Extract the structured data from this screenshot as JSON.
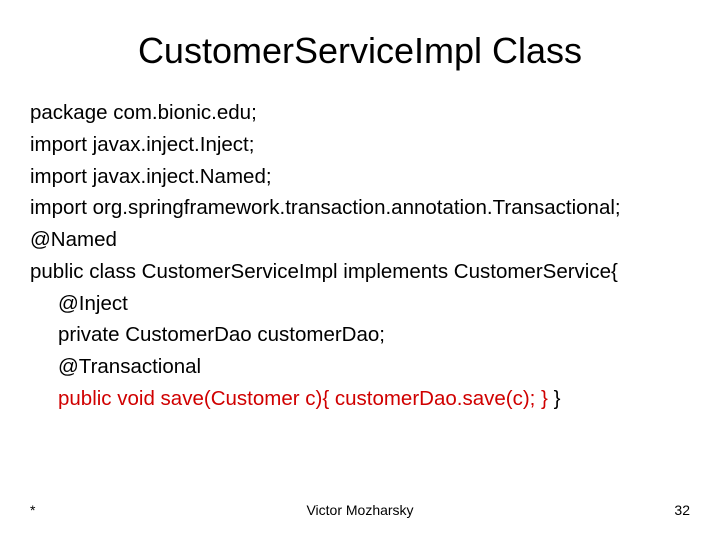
{
  "title": "CustomerServiceImpl Class",
  "code": {
    "l1": "package com.bionic.edu;",
    "l2": "import javax.inject.Inject;",
    "l3": "import javax.inject.Named;",
    "l4": "import org.springframework.transaction.annotation.Transactional;",
    "l5": "@Named",
    "l6": "public class CustomerServiceImpl implements CustomerService{",
    "l7": "@Inject",
    "l8": "private CustomerDao customerDao;",
    "l9": "@Transactional",
    "l10": "public void save(Customer c){ customerDao.save(c); }",
    "l10b": " }"
  },
  "footer": {
    "left": "*",
    "center": "Victor Mozharsky",
    "right": "32"
  }
}
